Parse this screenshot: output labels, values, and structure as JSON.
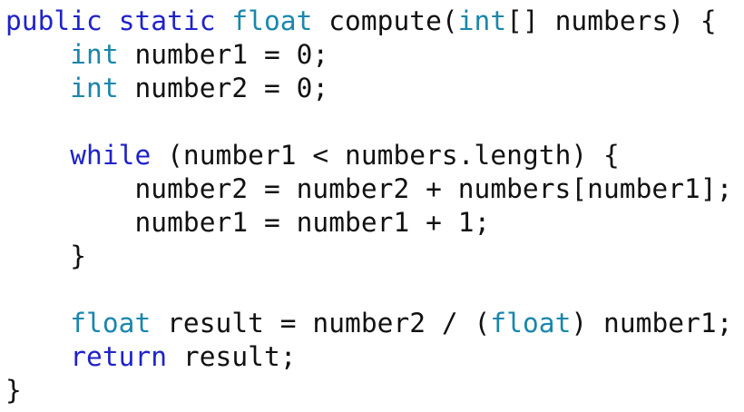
{
  "colors": {
    "keyword": "#1f22c9",
    "type": "#1a86ad",
    "text": "#111111",
    "background": "#ffffff"
  },
  "code": {
    "lines": [
      [
        {
          "t": "public",
          "k": "kw"
        },
        {
          "t": " ",
          "k": "p"
        },
        {
          "t": "static",
          "k": "kw"
        },
        {
          "t": " ",
          "k": "p"
        },
        {
          "t": "float",
          "k": "type"
        },
        {
          "t": " compute(",
          "k": "p"
        },
        {
          "t": "int",
          "k": "type"
        },
        {
          "t": "[] numbers) {",
          "k": "p"
        }
      ],
      [
        {
          "t": "    ",
          "k": "p"
        },
        {
          "t": "int",
          "k": "type"
        },
        {
          "t": " number1 = 0;",
          "k": "p"
        }
      ],
      [
        {
          "t": "    ",
          "k": "p"
        },
        {
          "t": "int",
          "k": "type"
        },
        {
          "t": " number2 = 0;",
          "k": "p"
        }
      ],
      [],
      [
        {
          "t": "    ",
          "k": "p"
        },
        {
          "t": "while",
          "k": "kw"
        },
        {
          "t": " (number1 < numbers.length) {",
          "k": "p"
        }
      ],
      [
        {
          "t": "        number2 = number2 + numbers[number1];",
          "k": "p"
        }
      ],
      [
        {
          "t": "        number1 = number1 + 1;",
          "k": "p"
        }
      ],
      [
        {
          "t": "    }",
          "k": "p"
        }
      ],
      [],
      [
        {
          "t": "    ",
          "k": "p"
        },
        {
          "t": "float",
          "k": "type"
        },
        {
          "t": " result = number2 / (",
          "k": "p"
        },
        {
          "t": "float",
          "k": "type"
        },
        {
          "t": ") number1;",
          "k": "p"
        }
      ],
      [
        {
          "t": "    ",
          "k": "p"
        },
        {
          "t": "return",
          "k": "kw"
        },
        {
          "t": " result;",
          "k": "p"
        }
      ],
      [
        {
          "t": "}",
          "k": "p"
        }
      ]
    ]
  }
}
